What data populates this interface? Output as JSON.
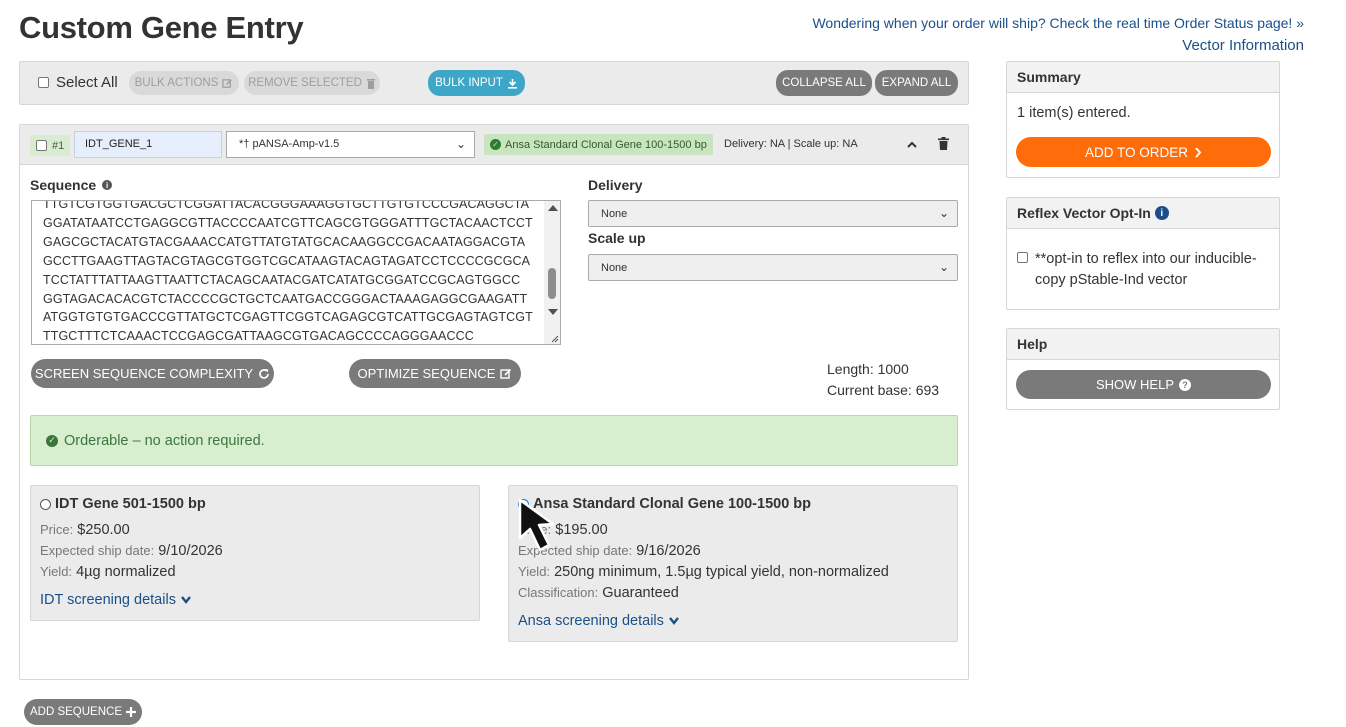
{
  "header": {
    "title": "Custom Gene Entry",
    "status_link": "Wondering when your order will ship? Check the real time Order Status page! »",
    "vector_link": "Vector Information"
  },
  "toolbar": {
    "select_all": "Select All",
    "bulk_actions": "BULK ACTIONS",
    "remove_selected": "REMOVE SELECTED",
    "bulk_input": "BULK INPUT",
    "collapse_all": "COLLAPSE ALL",
    "expand_all": "EXPAND ALL"
  },
  "gene": {
    "number": "#1",
    "name": "IDT_GENE_1",
    "vector": "*† pANSA-Amp-v1.5",
    "product_badge": "Ansa Standard Clonal Gene 100-1500 bp",
    "delivery_info": "Delivery: NA | Scale up: NA",
    "sequence_label": "Sequence",
    "sequence_lines": [
      "TTGTCGTGGTGACGCTCGGATTACACGGGAAAGGTGCTTGTGTCCCGACAGGCTA",
      "GGATATAATCCTGAGGCGTTACCCCAATCGTTCAGCGTGGGATTTGCTACAACTCCT",
      "GAGCGCTACATGTACGAAACCATGTTATGTATGCACAAGGCCGACAATAGGACGTA",
      "GCCTTGAAGTTAGTACGTAGCGTGGTCGCATAAGTACAGTAGATCCTCCCCGCGCA",
      "TCCTATTTATTAAGTTAATTCTACAGCAATACGATCATATGCGGATCCGCAGTGGCC",
      "GGTAGACACACGTCTACCCCGCTGCTCAATGACCGGGACTAAAGAGGCGAAGATT",
      "ATGGTGTGTGACCCGTTATGCTCGAGTTCGGTCAGAGCGTCATTGCGAGTAGTCGT",
      "TTGCTTTCTCAAACTCCGAGCGATTAAGCGTGACAGCCCCAGGGAACCC"
    ],
    "delivery_label": "Delivery",
    "delivery_value": "None",
    "scaleup_label": "Scale up",
    "scaleup_value": "None",
    "screen_button": "SCREEN SEQUENCE COMPLEXITY",
    "optimize_button": "OPTIMIZE SEQUENCE",
    "length_text": "Length: 1000",
    "current_base_text": "Current base: 693",
    "orderable_text": "Orderable – no action required.",
    "options": [
      {
        "title": "IDT Gene 501-1500 bp",
        "selected": false,
        "price_key": "Price:",
        "price": "$250.00",
        "ship_key": "Expected ship date:",
        "ship": "9/10/2026",
        "yield_key": "Yield:",
        "yield": "4µg normalized",
        "link": "IDT screening details"
      },
      {
        "title": "Ansa Standard Clonal Gene 100-1500 bp",
        "selected": true,
        "price_key": "Price:",
        "price": "$195.00",
        "ship_key": "Expected ship date:",
        "ship": "9/16/2026",
        "yield_key": "Yield:",
        "yield": "250ng minimum, 1.5µg typical yield, non-normalized",
        "class_key": "Classification:",
        "classification": "Guaranteed",
        "link": "Ansa screening details"
      }
    ]
  },
  "add_sequence": "ADD SEQUENCE",
  "sidebar": {
    "summary_title": "Summary",
    "items_entered": "1 item(s) entered.",
    "add_to_order": "ADD TO ORDER",
    "reflex_title": "Reflex Vector Opt-In",
    "reflex_text_1": "**opt-in to reflex into our inducible-",
    "reflex_text_2": "copy pStable-Ind vector",
    "help_title": "Help",
    "show_help": "SHOW HELP"
  },
  "colors": {
    "order_button": "#ff6c0a",
    "bulk_input": "#3ea7c8",
    "success_bg": "#d7efcf",
    "link": "#1b4f8a"
  }
}
